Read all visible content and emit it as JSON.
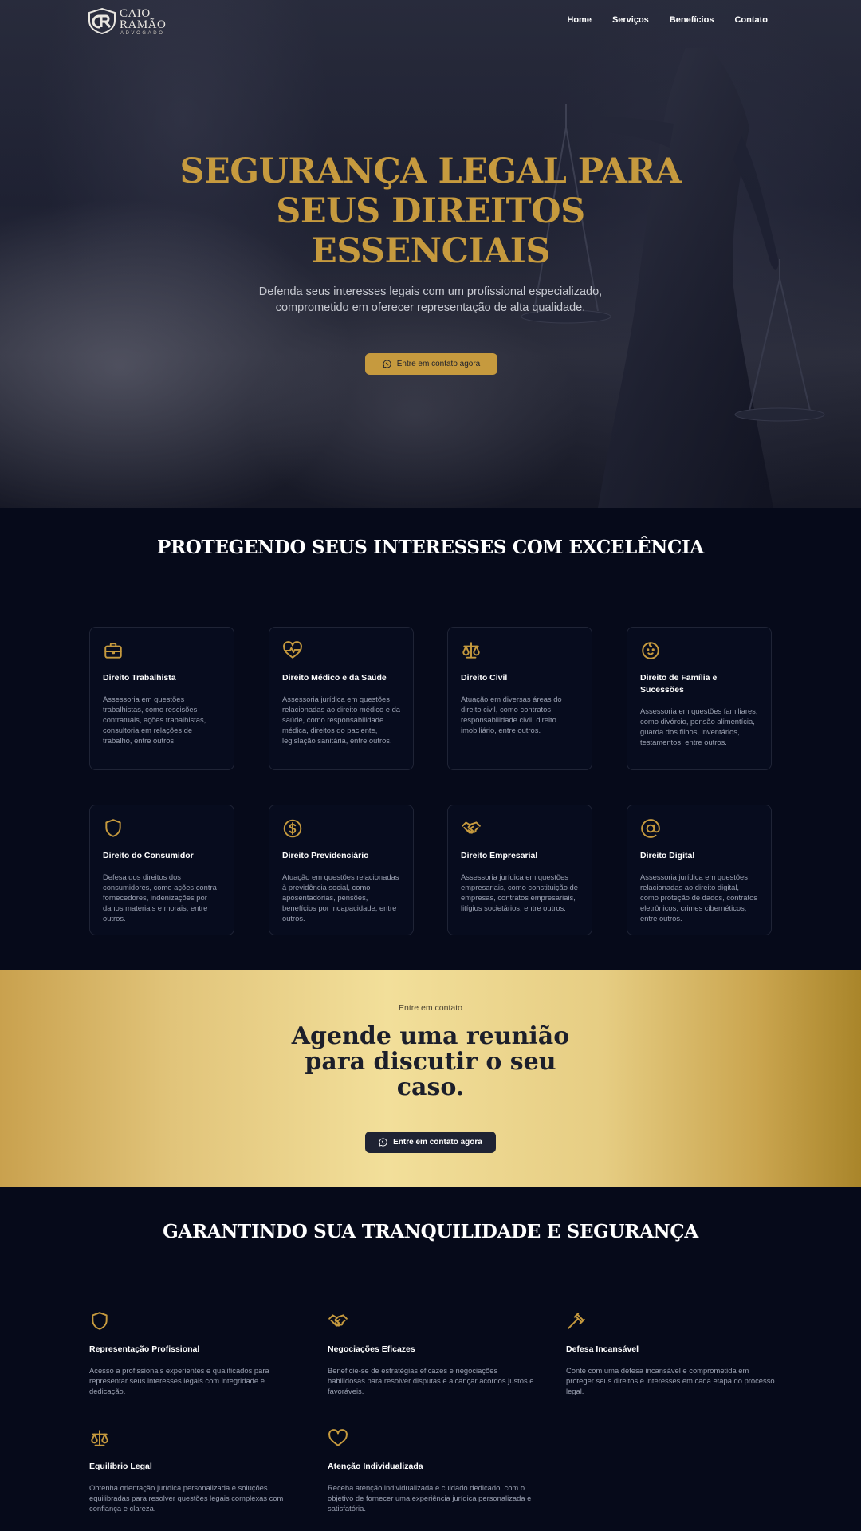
{
  "brand": {
    "name": "CAIO RAMÃO",
    "subtitle": "ADVOGADO",
    "gold": "#c69a3e",
    "navy": "#060a1a"
  },
  "nav": {
    "links": [
      "Home",
      "Serviços",
      "Benefícios",
      "Contato"
    ]
  },
  "hero": {
    "title": "SEGURANÇA LEGAL PARA SEUS DIREITOS ESSENCIAIS",
    "subtitle": "Defenda seus interesses legais com um profissional especializado, comprometido em oferecer representação de alta qualidade.",
    "cta_label": "Entre em contato agora",
    "cta_icon": "whatsapp-icon"
  },
  "services": {
    "title": "PROTEGENDO SEUS INTERESSES COM EXCELÊNCIA",
    "items": [
      {
        "icon": "briefcase-icon",
        "title": "Direito Trabalhista",
        "text": "Assessoria em questões trabalhistas, como rescisões contratuais, ações trabalhistas, consultoria em relações de trabalho, entre outros."
      },
      {
        "icon": "heart-pulse-icon",
        "title": "Direito Médico e da Saúde",
        "text": "Assessoria jurídica em questões relacionadas ao direito médico e da saúde, como responsabilidade médica, direitos do paciente, legislação sanitária, entre outros."
      },
      {
        "icon": "scale-icon",
        "title": "Direito Civil",
        "text": "Atuação em diversas áreas do direito civil, como contratos, responsabilidade civil, direito imobiliário, entre outros."
      },
      {
        "icon": "baby-icon",
        "title": "Direito de Família e Sucessões",
        "text": "Assessoria em questões familiares, como divórcio, pensão alimentícia, guarda dos filhos, inventários, testamentos, entre outros."
      },
      {
        "icon": "shield-icon",
        "title": "Direito do Consumidor",
        "text": "Defesa dos direitos dos consumidores, como ações contra fornecedores, indenizações por danos materiais e morais, entre outros."
      },
      {
        "icon": "dollar-circle-icon",
        "title": "Direito Previdenciário",
        "text": "Atuação em questões relacionadas à previdência social, como aposentadorias, pensões, benefícios por incapacidade, entre outros."
      },
      {
        "icon": "handshake-icon",
        "title": "Direito Empresarial",
        "text": "Assessoria jurídica em questões empresariais, como constituição de empresas, contratos empresariais, litígios societários, entre outros."
      },
      {
        "icon": "at-sign-icon",
        "title": "Direito Digital",
        "text": "Assessoria jurídica em questões relacionadas ao direito digital, como proteção de dados, contratos eletrônicos, crimes cibernéticos, entre outros."
      }
    ]
  },
  "cta": {
    "kicker": "Entre em contato",
    "title": "Agende uma reunião para discutir o seu caso.",
    "button_label": "Entre em contato agora",
    "button_icon": "whatsapp-icon"
  },
  "benefits": {
    "title": "GARANTINDO SUA TRANQUILIDADE E SEGURANÇA",
    "items": [
      {
        "icon": "shield-icon",
        "title": "Representação Profissional",
        "text": "Acesso a profissionais experientes e qualificados para representar seus interesses legais com integridade e dedicação."
      },
      {
        "icon": "handshake-icon",
        "title": "Negociações Eficazes",
        "text": "Beneficie-se de estratégias eficazes e negociações habilidosas para resolver disputas e alcançar acordos justos e favoráveis."
      },
      {
        "icon": "gavel-icon",
        "title": "Defesa Incansável",
        "text": "Conte com uma defesa incansável e comprometida em proteger seus direitos e interesses em cada etapa do processo legal."
      },
      {
        "icon": "scale-icon",
        "title": "Equilíbrio Legal",
        "text": "Obtenha orientação jurídica personalizada e soluções equilibradas para resolver questões legais complexas com confiança e clareza."
      },
      {
        "icon": "heart-icon",
        "title": "Atenção Individualizada",
        "text": "Receba atenção individualizada e cuidado dedicado, com o objetivo de fornecer uma experiência jurídica personalizada e satisfatória."
      }
    ]
  }
}
